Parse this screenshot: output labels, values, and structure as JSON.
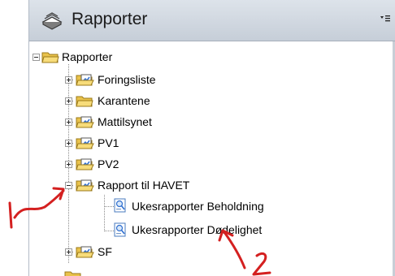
{
  "panel": {
    "title": "Rapporter",
    "header_icon": "book-stack-icon",
    "menu_icon": "panel-menu-dropdown-icon"
  },
  "tree": {
    "root": {
      "label": "Rapporter",
      "expanded": true,
      "icon": "folder-icon"
    },
    "items": [
      {
        "label": "Foringsliste",
        "expanded": false,
        "icon": "report-folder-icon"
      },
      {
        "label": "Karantene",
        "expanded": false,
        "icon": "folder-icon"
      },
      {
        "label": "Mattilsynet",
        "expanded": false,
        "icon": "report-folder-icon"
      },
      {
        "label": "PV1",
        "expanded": false,
        "icon": "report-folder-icon"
      },
      {
        "label": "PV2",
        "expanded": false,
        "icon": "report-folder-icon"
      },
      {
        "label": "Rapport til HAVET",
        "expanded": true,
        "icon": "report-folder-icon",
        "children": [
          {
            "label": "Ukesrapporter Beholdning",
            "icon": "report-document-icon"
          },
          {
            "label": "Ukesrapporter Dødelighet",
            "icon": "report-document-icon"
          }
        ]
      },
      {
        "label": "SF",
        "expanded": false,
        "icon": "report-folder-icon"
      }
    ]
  },
  "annotations": [
    {
      "text": "1",
      "color": "#d42020"
    },
    {
      "text": "2",
      "color": "#d42020"
    }
  ]
}
